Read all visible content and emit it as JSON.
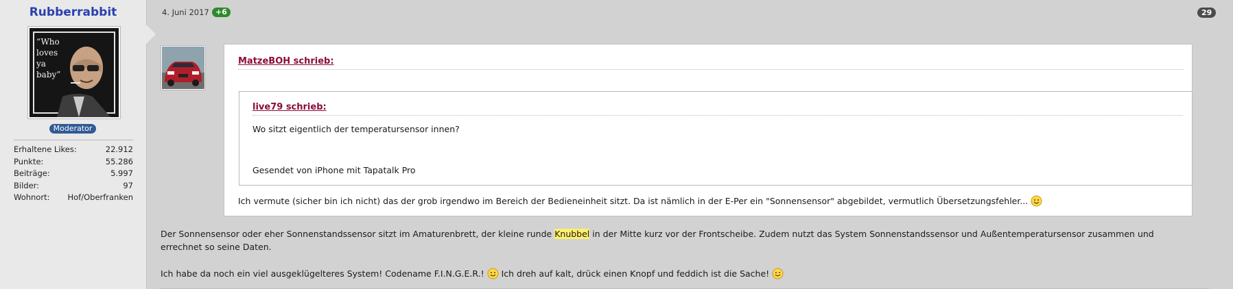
{
  "user": {
    "name": "Rubberrabbit",
    "role": "Moderator",
    "avatar_text": "Who loves ya baby",
    "stats": [
      {
        "label": "Erhaltene Likes:",
        "value": "22.912"
      },
      {
        "label": "Punkte:",
        "value": "55.286"
      },
      {
        "label": "Beiträge:",
        "value": "5.997"
      },
      {
        "label": "Bilder:",
        "value": "97"
      },
      {
        "label": "Wohnort:",
        "value": "Hof/Oberfranken"
      }
    ]
  },
  "post": {
    "date": "4. Juni 2017",
    "reaction_badge": "+6",
    "number": "29",
    "quote": {
      "author": "MatzeBOH schrieb:",
      "nested": {
        "author": "live79 schrieb:",
        "text": "Wo sitzt eigentlich der temperatursensor innen?",
        "signature": "Gesendet von iPhone mit Tapatalk Pro"
      },
      "text": "Ich vermute (sicher bin ich nicht) das der grob irgendwo im Bereich der Bedieneinheit sitzt. Da ist nämlich in der E-Per ein \"Sonnensensor\" abgebildet, vermutlich Übersetzungsfehler..."
    },
    "reply": {
      "p1_before": "Der Sonnensensor oder eher Sonnenstandssensor sitzt im Amaturenbrett, der kleine runde ",
      "p1_highlight": "Knubbel",
      "p1_after": " in der Mitte kurz vor der Frontscheibe. Zudem nutzt das System Sonnenstandssensor und Außentemperatursensor zusammen und errechnet so seine Daten.",
      "p2_part1": "Ich habe da noch ein viel ausgeklügelteres System! Codename F.I.N.G.E.R.!",
      "p2_part2": " Ich dreh auf kalt, drück einen Knopf und feddich ist die Sache!"
    }
  },
  "colors": {
    "username": "#2a3fb0",
    "quote_author": "#8c0b3b",
    "moderator_badge": "#315a96",
    "reaction_badge": "#2e8a2e",
    "highlight": "#fff06a"
  },
  "icons": [
    "smiley-icon",
    "user-avatar",
    "quote-user-avatar"
  ]
}
